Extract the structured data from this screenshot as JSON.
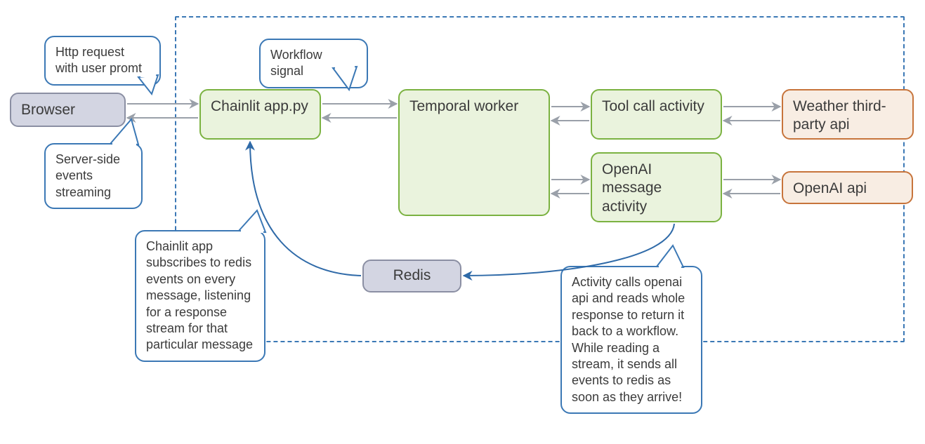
{
  "diagram": {
    "boundary_label": "",
    "nodes": {
      "browser": "Browser",
      "chainlit": "Chainlit app.py",
      "temporal": "Temporal worker",
      "toolcall": "Tool call activity",
      "openai_act": "OpenAI message activity",
      "redis": "Redis",
      "weather": "Weather third-party api",
      "openai_api": "OpenAI api"
    },
    "callouts": {
      "http_request": "Http request with user promt",
      "sse": "Server-side events streaming",
      "workflow_sig": "Workflow signal",
      "chainlit_note": "Chainlit app subscribes to redis events on every message, listening for a response stream for that particular message",
      "activity_note": "Activity calls openai api and reads whole response to return it back to a workflow. While reading a stream, it sends all events to redis as soon as they arrive!"
    }
  },
  "colors": {
    "boundary": "#3b78b5",
    "node_gray_border": "#8b8fa3",
    "node_gray_fill": "#d3d5e2",
    "node_green_border": "#7bb241",
    "node_green_fill": "#eaf3dd",
    "node_orange_border": "#c7743b",
    "node_orange_fill": "#f8ede3",
    "arrow_gray": "#9aa0a9",
    "arrow_blue": "#2f6aa8"
  }
}
